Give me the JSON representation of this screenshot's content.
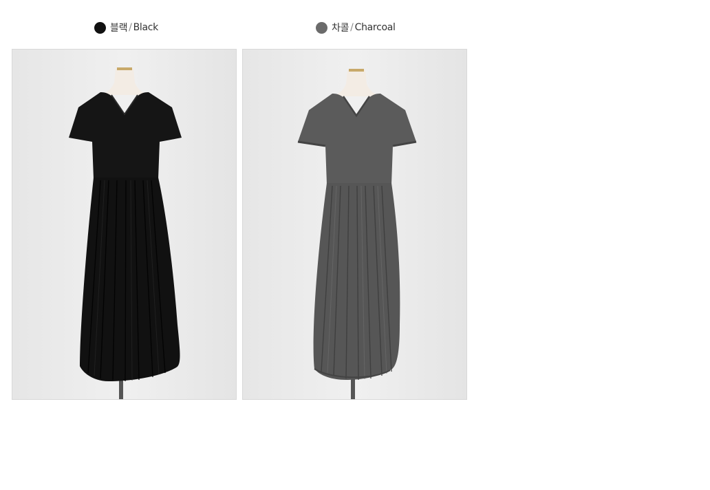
{
  "colors": [
    {
      "id": "black",
      "name_ko": "블랙",
      "separator": "/",
      "name_en": "Black",
      "swatch": "#111111",
      "dress_color": "#111111",
      "dress_shade": "#000000",
      "dress_highlight": "#2a2a2a"
    },
    {
      "id": "charcoal",
      "name_ko": "차콜",
      "separator": "/",
      "name_en": "Charcoal",
      "swatch": "#6b6b6b",
      "dress_color": "#5a5a5a",
      "dress_shade": "#444444",
      "dress_highlight": "#6e6e6e"
    }
  ],
  "background_color": "#ececec",
  "mannequin_color": "#f2ece6"
}
